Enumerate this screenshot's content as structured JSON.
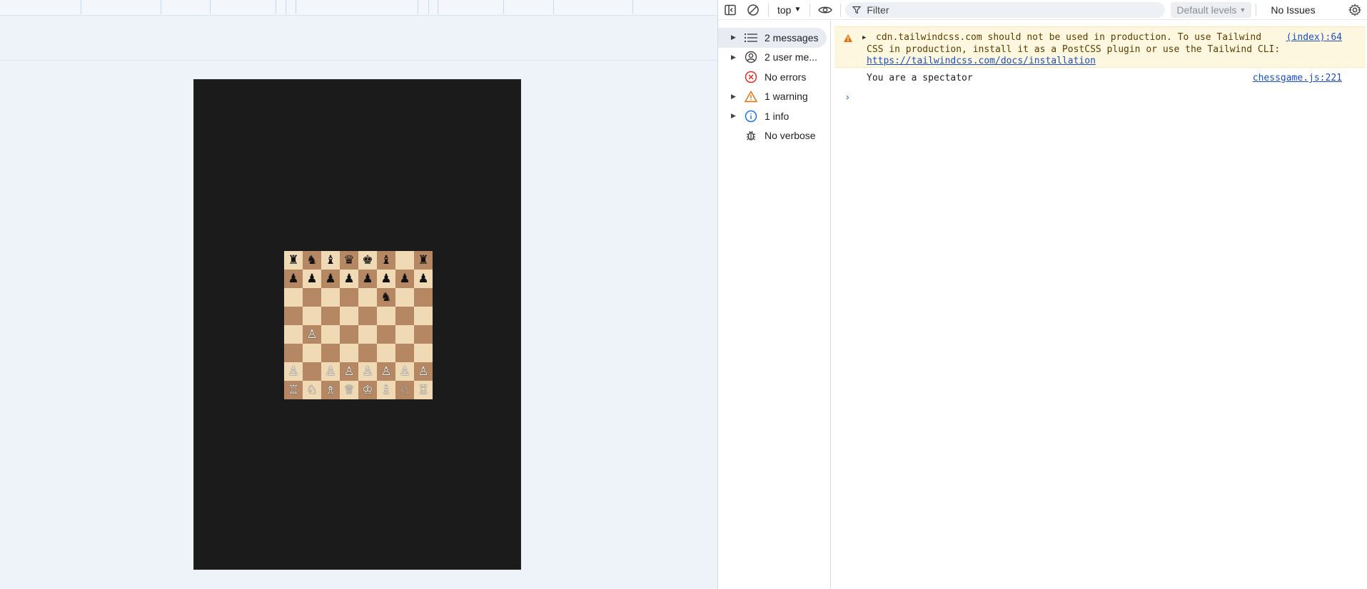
{
  "board": {
    "rows": [
      [
        "r",
        "n",
        "b",
        "q",
        "k",
        "b",
        "",
        "r"
      ],
      [
        "p",
        "p",
        "p",
        "p",
        "p",
        "p",
        "p",
        "p"
      ],
      [
        "",
        "",
        "",
        "",
        "",
        "n",
        "",
        ""
      ],
      [
        "",
        "",
        "",
        "",
        "",
        "",
        "",
        ""
      ],
      [
        "",
        "P",
        "",
        "",
        "",
        "",
        "",
        ""
      ],
      [
        "",
        "",
        "",
        "",
        "",
        "",
        "",
        ""
      ],
      [
        "P",
        "",
        "P",
        "P",
        "P",
        "P",
        "P",
        "P"
      ],
      [
        "R",
        "N",
        "B",
        "Q",
        "K",
        "B",
        "N",
        "R"
      ]
    ],
    "glyphs": {
      "K": "♔",
      "Q": "♕",
      "R": "♖",
      "B": "♗",
      "N": "♘",
      "P": "♙",
      "k": "♚",
      "q": "♛",
      "r": "♜",
      "b": "♝",
      "n": "♞",
      "p": "♟"
    },
    "colors": {
      "light": "#f0d9b5",
      "dark": "#b58863",
      "frame": "#1b1b1c"
    }
  },
  "devtools": {
    "toolbar": {
      "context": "top",
      "filter_placeholder": "Filter",
      "levels": "Default levels",
      "issues": "No Issues"
    },
    "sidebar": {
      "items": [
        {
          "label": "2 messages",
          "icon": "list-icon",
          "expandable": true,
          "selected": true
        },
        {
          "label": "2 user me...",
          "icon": "user-icon",
          "expandable": true,
          "selected": false
        },
        {
          "label": "No errors",
          "icon": "error-icon",
          "expandable": false,
          "selected": false
        },
        {
          "label": "1 warning",
          "icon": "warning-icon",
          "expandable": true,
          "selected": false
        },
        {
          "label": "1 info",
          "icon": "info-icon",
          "expandable": true,
          "selected": false
        },
        {
          "label": "No verbose",
          "icon": "bug-icon",
          "expandable": false,
          "selected": false
        }
      ]
    },
    "console": {
      "warning": {
        "line1": "cdn.tailwindcss.com should not be used in production. To use Tailwind",
        "line2": "CSS in production, install it as a PostCSS plugin or use the Tailwind CLI:",
        "link": "https://tailwindcss.com/docs/installation",
        "source": "(index):64"
      },
      "log": {
        "message": "You are a spectator",
        "source": "chessgame.js:221"
      },
      "prompt_symbol": "›"
    }
  },
  "colors": {
    "accent": "#1a73e8",
    "warning_bg": "#fef7e0",
    "warning_icon": "#e8710a",
    "error_icon": "#d93025",
    "link": "#1a4fc2"
  }
}
